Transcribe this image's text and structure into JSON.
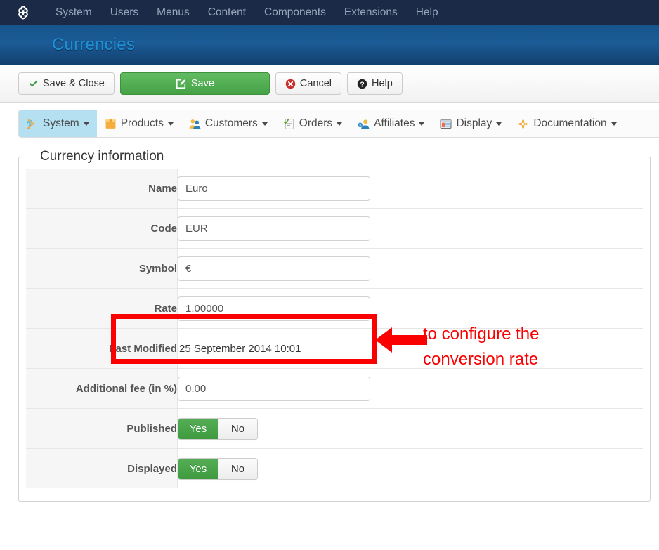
{
  "topbar": {
    "logo_icon": "joomla-logo-icon",
    "items": [
      {
        "label": "System"
      },
      {
        "label": "Users"
      },
      {
        "label": "Menus"
      },
      {
        "label": "Content"
      },
      {
        "label": "Components"
      },
      {
        "label": "Extensions"
      },
      {
        "label": "Help"
      }
    ]
  },
  "subheader": {
    "title": "Currencies",
    "title_color": "#1e8fd5",
    "background_color": "#16548c"
  },
  "toolbar": {
    "save_close_label": "Save & Close",
    "save_close_icon": "checkmark-icon",
    "save_label": "Save",
    "save_icon": "edit-pencil-icon",
    "save_color": "#45a245",
    "cancel_label": "Cancel",
    "cancel_icon": "close-circle-icon",
    "cancel_icon_color": "#c9302c",
    "help_label": "Help",
    "help_icon": "question-circle-icon"
  },
  "nav": {
    "tabs": [
      {
        "label": "System",
        "icon": "tools-icon",
        "active": true,
        "caret": true
      },
      {
        "label": "Products",
        "icon": "box-icon",
        "active": false,
        "caret": true
      },
      {
        "label": "Customers",
        "icon": "users-icon",
        "active": false,
        "caret": true
      },
      {
        "label": "Orders",
        "icon": "checklist-icon",
        "active": false,
        "caret": true
      },
      {
        "label": "Affiliates",
        "icon": "affiliate-user-icon",
        "active": false,
        "caret": true
      },
      {
        "label": "Display",
        "icon": "window-icon",
        "active": false,
        "caret": true
      },
      {
        "label": "Documentation",
        "icon": "puzzle-icon",
        "active": false,
        "caret": true
      }
    ],
    "active_tab_color": "#b4e0f2"
  },
  "form": {
    "legend": "Currency information",
    "rows": [
      {
        "label": "Name",
        "type": "text",
        "value": "Euro",
        "name": "name-field"
      },
      {
        "label": "Code",
        "type": "text",
        "value": "EUR",
        "name": "code-field"
      },
      {
        "label": "Symbol",
        "type": "text",
        "value": "€",
        "name": "symbol-field"
      },
      {
        "label": "Rate",
        "type": "text",
        "value": "1.00000",
        "name": "rate-field"
      },
      {
        "label": "Last Modified",
        "type": "static",
        "value": "25 September 2014 10:01",
        "name": "last-modified-value"
      },
      {
        "label": "Additional fee (in %)",
        "type": "text",
        "value": "0.00",
        "name": "additional-fee-field"
      },
      {
        "label": "Published",
        "type": "toggle",
        "value": "Yes",
        "name": "published-toggle"
      },
      {
        "label": "Displayed",
        "type": "toggle",
        "value": "Yes",
        "name": "displayed-toggle"
      }
    ],
    "toggle_yes_label": "Yes",
    "toggle_no_label": "No"
  },
  "annotation": {
    "text_line1": "to configure the",
    "text_line2": "conversion rate",
    "color": "#fb0000"
  }
}
